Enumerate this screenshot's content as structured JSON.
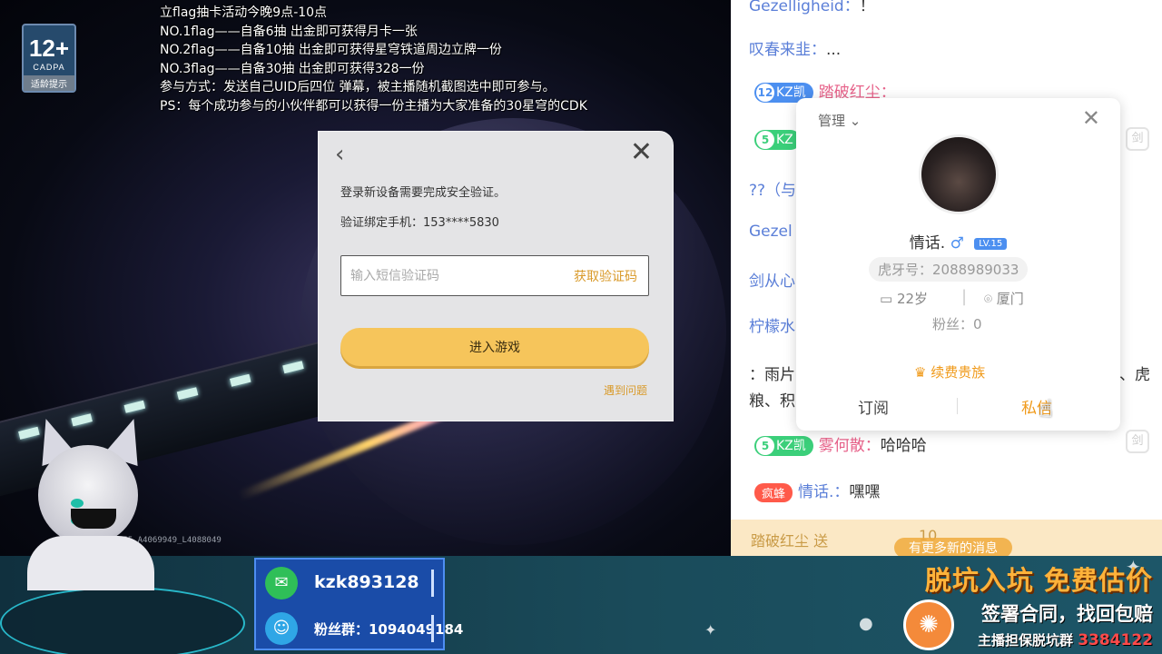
{
  "age_rating": {
    "number": "12+",
    "org": "CADPA",
    "tip": "适龄提示"
  },
  "notice": {
    "lines": [
      "立flag抽卡活动今晚9点-10点",
      "NO.1flag——自备6抽   出金即可获得月卡一张",
      "NO.2flag——自备10抽 出金即可获得星穹铁道周边立牌一份",
      "NO.3flag——自备30抽 出金即可获得328一份",
      "参与方式：发送自己UID后四位 弹幕，被主播随机截图选中即可参与。",
      "PS：每个成功参与的小伙伴都可以获得一份主播为大家准备的30星穹的CDK"
    ]
  },
  "build_id": "155_A4069949_L4088049",
  "login_dialog": {
    "back_icon": "‹",
    "close_icon": "✕",
    "message": "登录新设备需要完成安全验证。",
    "phone_line": "验证绑定手机：153****5830",
    "sms_placeholder": "输入短信验证码",
    "get_code_label": "获取验证码",
    "enter_game_label": "进入游戏",
    "help_label": "遇到问题"
  },
  "chat": {
    "rows": [
      {
        "user": "Gezelligheid：",
        "msg": "！"
      },
      {
        "user": "叹春来韭：",
        "msg": "..."
      },
      {
        "badge_level": "12",
        "badge_text": "KZ凯",
        "user": "踏破红尘：",
        "msg": ""
      },
      {
        "badge_level": "5",
        "badge_text": "KZ",
        "user": "",
        "msg": ""
      },
      {
        "user": "??（与",
        "msg": ""
      },
      {
        "user": "Gezel",
        "msg": ""
      },
      {
        "user": "剑从心",
        "msg": ""
      },
      {
        "user": "柠檬水",
        "msg": ""
      },
      {
        "user": "：雨片",
        "msg": "、虎"
      },
      {
        "user": "粮、积",
        "msg": ""
      },
      {
        "badge_level": "5",
        "badge_text": "KZ凯",
        "user": "雾何散：",
        "msg": "哈哈哈"
      },
      {
        "tag": "疯蜂",
        "user": "情话.：",
        "msg": "嘿嘿"
      }
    ],
    "side_icon": "剑",
    "gift_bar": {
      "who": "踏破红尘 送",
      "count": "10"
    },
    "more_messages": "有更多新的消息"
  },
  "user_card": {
    "manage_label": "管理",
    "name": "情话.",
    "gender_symbol": "♂",
    "level_badge": "LV.15",
    "huya_id": "虎牙号：2088989033",
    "age": "22岁",
    "city": "厦门",
    "fans": "粉丝：0",
    "renew_label": "续费贵族",
    "subscribe_label": "订阅",
    "private_msg_label": "私信"
  },
  "overlay": {
    "wechat": "kzk893128",
    "qq_group": "粉丝群：1094049184",
    "promo_line1": "脱坑入坑 免费估价",
    "promo_line2": "签署合同，找回包赔",
    "promo_line3_prefix": "主播担保脱坑群",
    "promo_line3_num": "3384122"
  }
}
